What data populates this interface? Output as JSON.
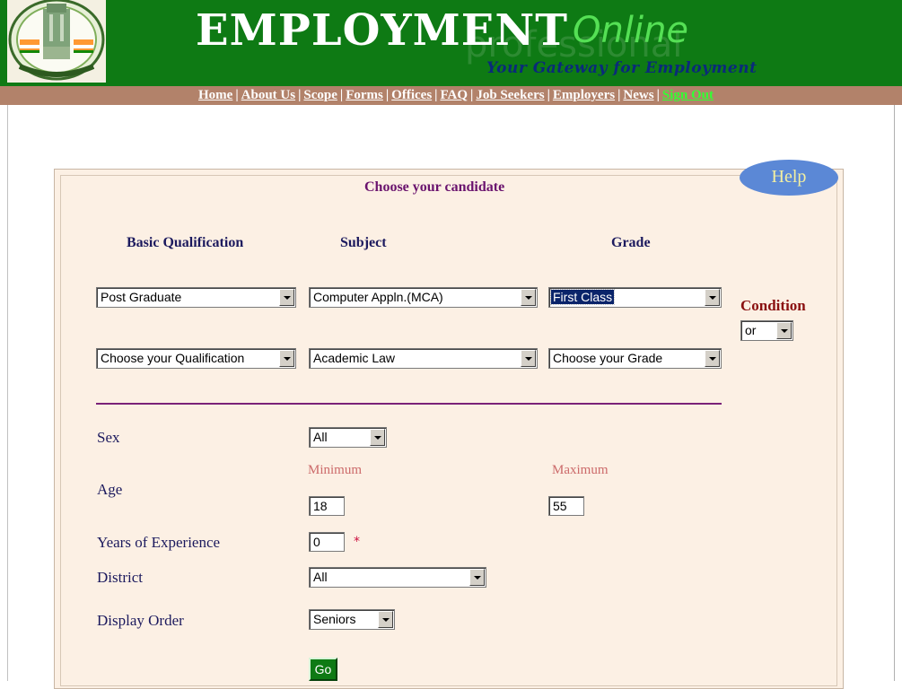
{
  "header": {
    "title_main": "EMPLOYMENT",
    "title_accent": "Online",
    "watermark": "professional",
    "tagline": "Your Gateway for Employment"
  },
  "nav": {
    "links": [
      "Home",
      "About Us",
      "Scope",
      "Forms",
      "Offices",
      "FAQ",
      "Job Seekers",
      "Employers",
      "News",
      "Sign Out"
    ],
    "separator": "|"
  },
  "help_label": "Help",
  "panel_title": "Choose your candidate",
  "columns": {
    "qualification": "Basic Qualification",
    "subject": "Subject",
    "grade": "Grade"
  },
  "rows": [
    {
      "qualification": "Post Graduate",
      "subject": "Computer Appln.(MCA)",
      "grade": "First Class"
    },
    {
      "qualification": "Choose your Qualification",
      "subject": "Academic Law",
      "grade": "Choose your Grade"
    }
  ],
  "condition": {
    "label": "Condition",
    "value": "or"
  },
  "fields": {
    "sex": {
      "label": "Sex",
      "value": "All"
    },
    "age": {
      "label": "Age",
      "min_label": "Minimum",
      "max_label": "Maximum",
      "min_value": "18",
      "max_value": "55"
    },
    "experience": {
      "label": "Years of Experience",
      "value": "0",
      "required_mark": "*"
    },
    "district": {
      "label": "District",
      "value": "All"
    },
    "display_order": {
      "label": "Display Order",
      "value": "Seniors"
    }
  },
  "go_label": "Go",
  "colors": {
    "header_green": "#0e7a14",
    "navbar": "#b2826a",
    "panel_bg": "#fcf0e4",
    "divider": "#7a2178",
    "help_button": "#5b88d6"
  }
}
